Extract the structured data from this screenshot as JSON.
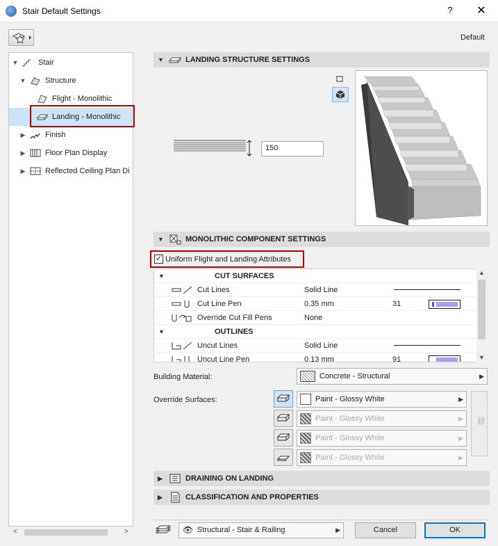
{
  "window": {
    "title": "Stair Default Settings",
    "help": "?",
    "close": "✕"
  },
  "header": {
    "default_label": "Default"
  },
  "tree": {
    "items": [
      {
        "label": "Stair",
        "icon": "stair-icon"
      },
      {
        "label": "Structure",
        "icon": "structure-icon"
      },
      {
        "label": "Flight - Monolithic",
        "icon": "flight-icon"
      },
      {
        "label": "Landing - Monolithic",
        "icon": "landing-icon",
        "selected": true
      },
      {
        "label": "Finish",
        "icon": "finish-icon"
      },
      {
        "label": "Floor Plan Display",
        "icon": "floor-plan-icon"
      },
      {
        "label": "Reflected Ceiling Plan Di",
        "icon": "ceiling-plan-icon"
      }
    ]
  },
  "landing_structure": {
    "title": "LANDING STRUCTURE SETTINGS",
    "thickness": "150"
  },
  "monolithic": {
    "title": "MONOLITHIC COMPONENT SETTINGS",
    "uniform_label": "Uniform Flight and Landing Attributes",
    "uniform_checked": true,
    "groups": {
      "cut_surfaces": "CUT SURFACES",
      "outlines": "OUTLINES"
    },
    "rows": [
      {
        "name": "Cut Lines",
        "value": "Solid Line",
        "num": ""
      },
      {
        "name": "Cut Line Pen",
        "value": "0.35 mm",
        "num": "31"
      },
      {
        "name": "Override Cut Fill Pens",
        "value": "None",
        "num": ""
      },
      {
        "name": "Uncut Lines",
        "value": "Solid Line",
        "num": ""
      },
      {
        "name": "Uncut Line Pen",
        "value": "0.13 mm",
        "num": "91"
      }
    ],
    "building_material_label": "Building Material:",
    "building_material": "Concrete - Structural",
    "override_surfaces_label": "Override Surfaces:",
    "surfaces": [
      "Paint - Glossy White",
      "Paint - Glossy White",
      "Paint - Glossy White",
      "Paint - Glossy White"
    ]
  },
  "draining": {
    "title": "DRAINING ON LANDING"
  },
  "classification": {
    "title": "CLASSIFICATION AND PROPERTIES"
  },
  "footer": {
    "layer": "Structural - Stair & Railing",
    "cancel": "Cancel",
    "ok": "OK"
  },
  "colors": {
    "selection": "#cce4f7",
    "highlight_border": "#c00000",
    "pen_dark": "#5552e0",
    "pen_light": "#a3a3f0"
  }
}
